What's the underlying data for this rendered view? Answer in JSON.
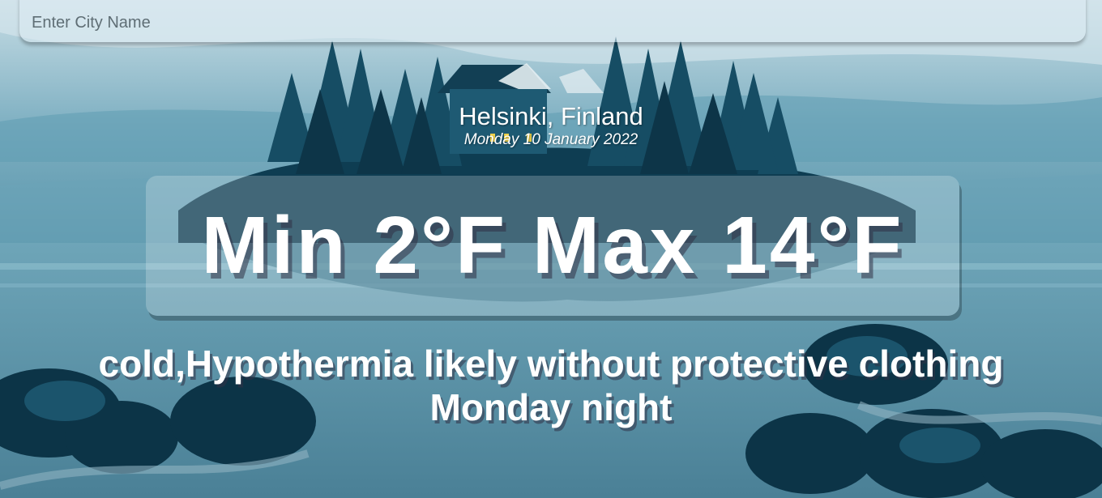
{
  "search": {
    "placeholder": "Enter City Name",
    "value": ""
  },
  "location": {
    "city": "Helsinki, Finland",
    "date": "Monday 10 January 2022"
  },
  "temperature": {
    "text": "Min 2°F Max 14°F"
  },
  "weather": {
    "description": "cold,Hypothermia likely without protective clothing",
    "period": "Monday night"
  },
  "colors": {
    "sky": "#4d8ea6",
    "lake": "#5e9bb0",
    "forest": "#0f3f55",
    "text": "#ffffff"
  }
}
